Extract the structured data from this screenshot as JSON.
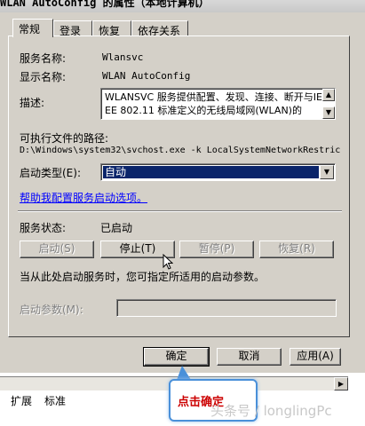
{
  "window": {
    "title": "WLAN AutoConfig 的属性（本地计算机）"
  },
  "tabs": [
    {
      "label": "常规",
      "active": true
    },
    {
      "label": "登录",
      "active": false
    },
    {
      "label": "恢复",
      "active": false
    },
    {
      "label": "依存关系",
      "active": false
    }
  ],
  "general": {
    "service_name_label": "服务名称:",
    "service_name_value": "Wlansvc",
    "display_name_label": "显示名称:",
    "display_name_value": "WLAN AutoConfig",
    "description_label": "描述:",
    "description_text": "WLANSVC 服务提供配置、发现、连接、断开与IEEE 802.11 标准定义的无线局域网(WLAN)的",
    "exe_path_label": "可执行文件的路径:",
    "exe_path_value": "D:\\Windows\\system32\\svchost.exe -k LocalSystemNetworkRestric",
    "startup_type_label": "启动类型(E):",
    "startup_type_value": "自动",
    "help_link": "帮助我配置服务启动选项。",
    "service_status_label": "服务状态:",
    "service_status_value": "已启动",
    "buttons": {
      "start": "启动(S)",
      "stop": "停止(T)",
      "pause": "暂停(P)",
      "resume": "恢复(R)"
    },
    "hint_text": "当从此处启动服务时，您可指定所适用的启动参数。",
    "start_params_label": "启动参数(M):",
    "start_params_value": ""
  },
  "dialog_buttons": {
    "ok": "确定",
    "cancel": "取消",
    "apply": "应用(A)"
  },
  "background": {
    "bottom_tabs": [
      "扩展",
      "标准"
    ]
  },
  "annotation": {
    "callout_text": "点击确定"
  },
  "watermark": "头条号 / longlingPc",
  "colors": {
    "dialog_bg": "#d4d0c8",
    "selection": "#0a246a",
    "link": "#0000ff",
    "callout_border": "#4a90d9",
    "callout_text": "#cc0000"
  },
  "icons": [
    "scroll-up-icon",
    "scroll-down-icon",
    "dropdown-arrow-icon",
    "mouse-cursor-icon",
    "scroll-right-icon"
  ]
}
